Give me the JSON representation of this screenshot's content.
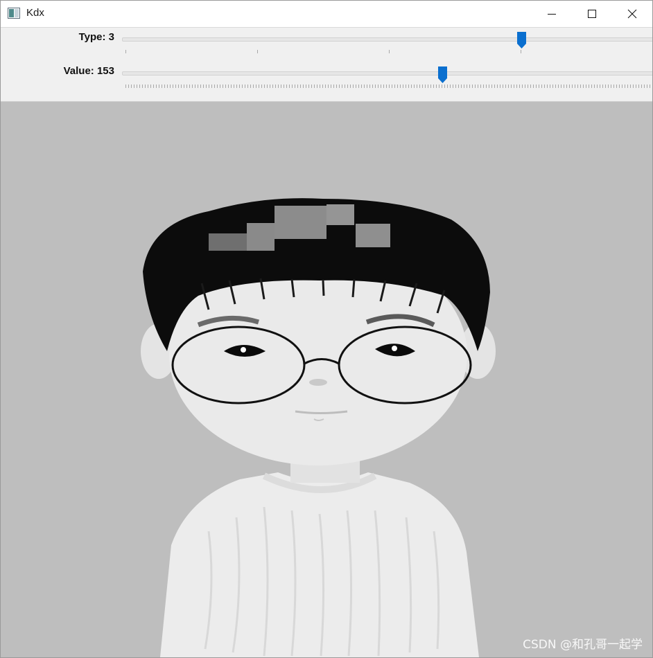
{
  "window": {
    "title": "Kdx"
  },
  "trackbars": [
    {
      "label": "Type: 3",
      "value": 3,
      "max": 4
    },
    {
      "label": "Value: 153",
      "value": 153,
      "max": 255
    }
  ],
  "watermark": "CSDN @和孔哥一起学"
}
